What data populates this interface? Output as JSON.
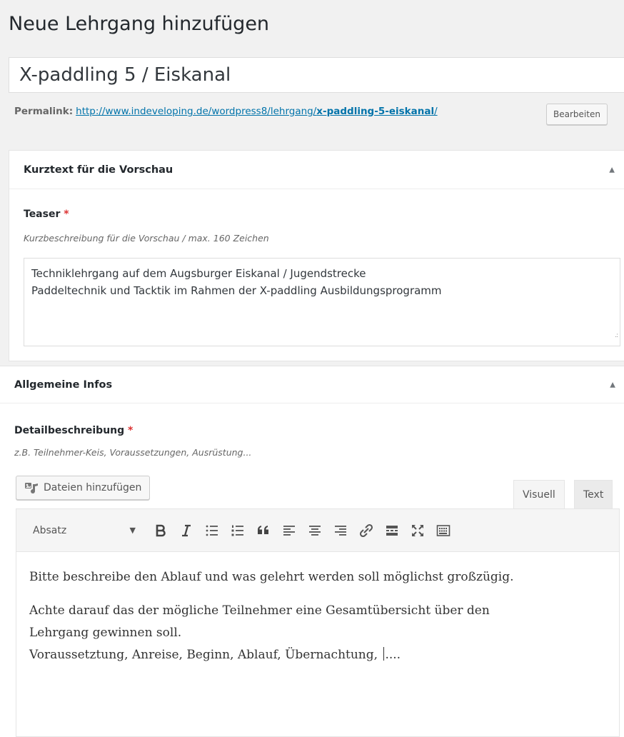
{
  "header": {
    "title": "Neue Lehrgang hinzufügen"
  },
  "post": {
    "title_value": "X-paddling 5 / Eiskanal"
  },
  "permalink": {
    "label": "Permalink:",
    "url_base": "http://www.indeveloping.de/wordpress8/lehrgang/",
    "slug": "x-paddling-5-eiskanal",
    "url_suffix": "/",
    "edit_label": "Bearbeiten"
  },
  "box_preview": {
    "title": "Kurztext für die Vorschau",
    "toggle_icon": "arrow-up-icon",
    "field_label": "Teaser",
    "required_mark": "*",
    "field_description": "Kurzbeschreibung für die Vorschau / max. 160 Zeichen",
    "value_line1": "Techniklehrgang auf dem Augsburger Eiskanal / Jugendstrecke",
    "value_line2": "Paddeltechnik und Tacktik im Rahmen der X-paddling Ausbildungsprogramm"
  },
  "box_general": {
    "title": "Allgemeine Infos",
    "toggle_icon": "arrow-up-icon",
    "field_label": "Detailbeschreibung",
    "required_mark": "*",
    "field_description": "z.B. Teilnehmer-Keis, Voraussetzungen, Ausrüstung..."
  },
  "editor": {
    "add_media_label": "Dateien hinzufügen",
    "tab_visual": "Visuell",
    "tab_text": "Text",
    "format_selected": "Absatz",
    "toolbar_icons": [
      "bold-icon",
      "italic-icon",
      "bullet-list-icon",
      "numbered-list-icon",
      "blockquote-icon",
      "align-left-icon",
      "align-center-icon",
      "align-right-icon",
      "link-icon",
      "read-more-icon",
      "fullscreen-icon",
      "toolbar-toggle-icon"
    ],
    "paragraph1": "Bitte beschreibe den Ablauf und was gelehrt werden soll möglichst großzügig.",
    "paragraph2_line1": "Achte darauf das der mögliche Teilnehmer eine Gesamtübersicht über den",
    "paragraph2_line2": "Lehrgang gewinnen soll.",
    "paragraph2_line3_before": "Voraussetztung, Anreise, Beginn, Ablauf, Übernachtung, ",
    "paragraph2_line3_after": "...."
  }
}
